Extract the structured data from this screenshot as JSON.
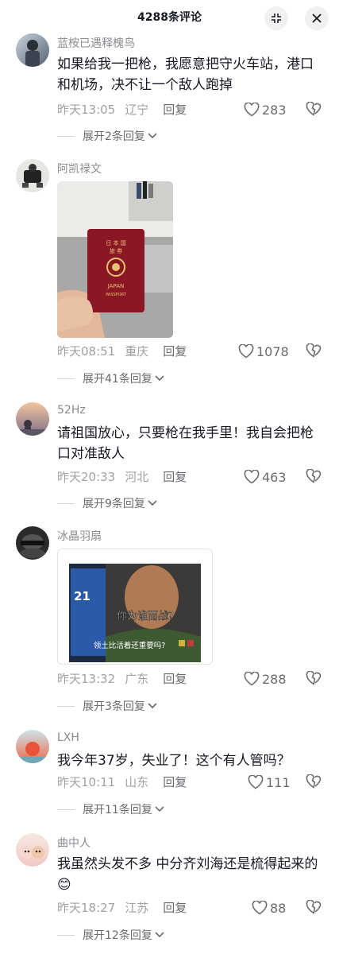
{
  "header": {
    "title": "4288条评论"
  },
  "comments": [
    {
      "user": "蓝桉已遇释槐鸟",
      "text": "如果给我一把枪，我愿意把守火车站，港口和机场，决不让一个敌人跑掉",
      "time": "昨天13:05",
      "location": "辽宁",
      "reply": "回复",
      "likes": "283",
      "expand": "展开2条回复"
    },
    {
      "user": "阿凯禄文",
      "text": "",
      "time": "昨天08:51",
      "location": "重庆",
      "reply": "回复",
      "likes": "1078",
      "expand": "展开41条回复",
      "image": {
        "passport_line1": "日 本 国",
        "passport_line2": "旅 券",
        "passport_line3": "JAPAN",
        "passport_line4": "PASSPORT"
      }
    },
    {
      "user": "52Hz",
      "text": "请祖国放心，只要枪在我手里！我自会把枪口对准敌人",
      "time": "昨天20:33",
      "location": "河北",
      "reply": "回复",
      "likes": "463",
      "expand": "展开9条回复"
    },
    {
      "user": "冰晶羽扇",
      "text": "",
      "time": "昨天13:32",
      "location": "广东",
      "reply": "回复",
      "likes": "288",
      "expand": "展开3条回复",
      "image": {
        "caption1": "你为谁而战?",
        "caption2": "领土比活着还重要吗?"
      }
    },
    {
      "user": "LXH",
      "text": "我今年37岁，失业了！这个有人管吗？",
      "time": "昨天10:11",
      "location": "山东",
      "reply": "回复",
      "likes": "111",
      "expand": "展开11条回复"
    },
    {
      "user": "曲中人",
      "text": "我虽然头发不多 中分齐刘海还是梳得起来的😊",
      "time": "昨天18:27",
      "location": "江苏",
      "reply": "回复",
      "likes": "88",
      "expand": "展开12条回复"
    }
  ]
}
